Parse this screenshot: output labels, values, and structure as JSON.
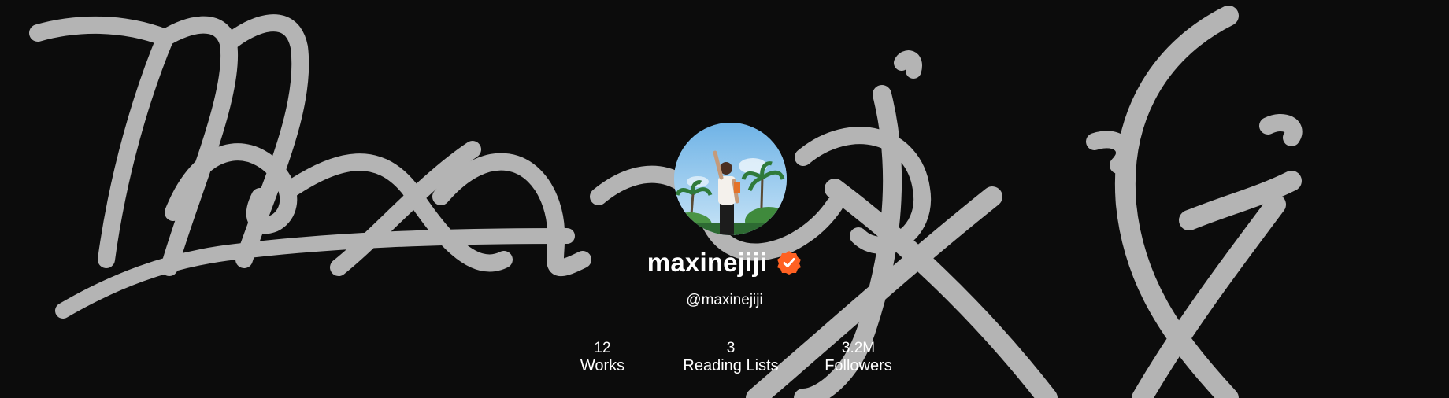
{
  "profile": {
    "display_name": "maxinejiji",
    "handle": "@maxinejiji",
    "verified": true,
    "avatar_icon": "profile-photo"
  },
  "stats": {
    "works": {
      "count": "12",
      "label": "Works"
    },
    "reading_lists": {
      "count": "3",
      "label": "Reading Lists"
    },
    "followers": {
      "count": "3.2M",
      "label": "Followers"
    }
  },
  "colors": {
    "background": "#0c0c0c",
    "signature": "#b4b4b4",
    "verified_badge": "#ff6122",
    "text": "#ffffff"
  }
}
